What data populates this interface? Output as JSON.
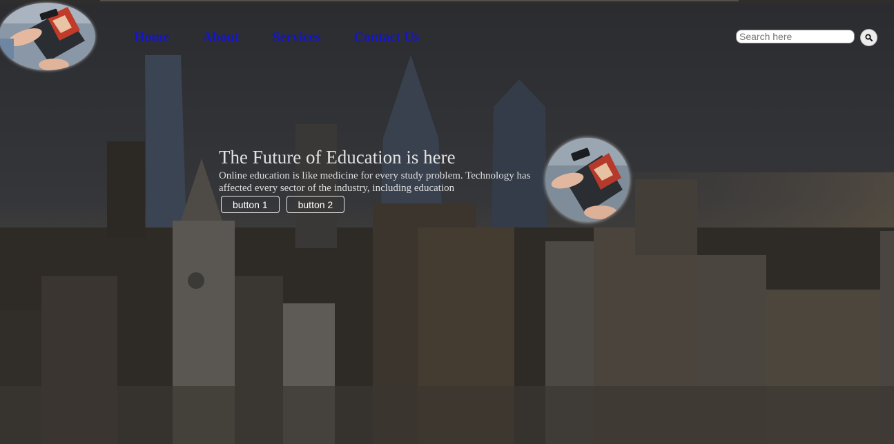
{
  "nav": {
    "items": [
      {
        "label": "Home"
      },
      {
        "label": "About"
      },
      {
        "label": "Services"
      },
      {
        "label": "Contact Us"
      }
    ]
  },
  "search": {
    "placeholder": "Search here",
    "icon": "search-icon"
  },
  "hero": {
    "title": "The Future of Education is here",
    "description": "Online education is like medicine for every study problem. Technology has affected every sector of the industry, including education",
    "buttons": [
      {
        "label": "button 1"
      },
      {
        "label": "button 2"
      }
    ]
  },
  "colors": {
    "nav_link": "#1515c9",
    "overlay": "#1c1c1e",
    "hero_text": "#e2e2e2"
  }
}
